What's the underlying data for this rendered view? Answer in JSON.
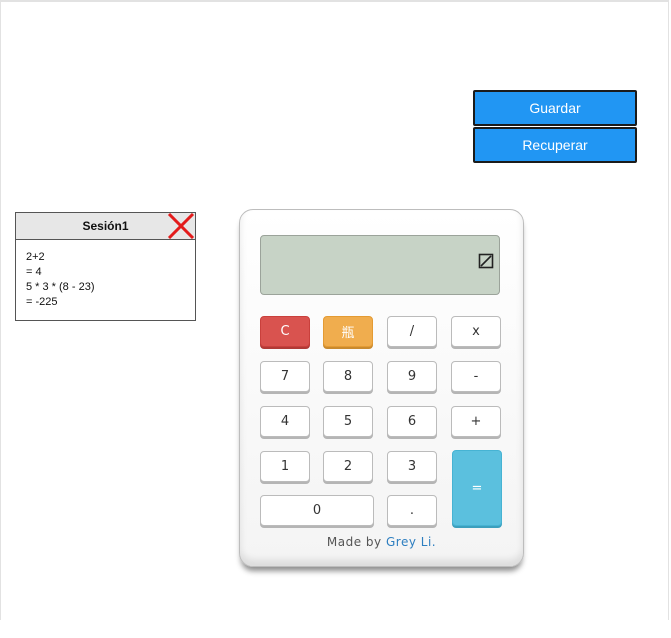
{
  "toolbar": {
    "save_label": "Guardar",
    "restore_label": "Recuperar"
  },
  "session": {
    "title": "Sesión1",
    "lines": [
      "2+2",
      "= 4",
      "5 * 3 * (8 - 23)",
      "= -225"
    ],
    "close_icon": "close-x-icon",
    "close_color": "#e31b1b"
  },
  "calculator": {
    "display_icon": "backspace-square-icon",
    "keys": {
      "clear": "C",
      "orange": "瓶",
      "divide": "/",
      "multiply": "x",
      "seven": "7",
      "eight": "8",
      "nine": "9",
      "minus": "-",
      "four": "4",
      "five": "5",
      "six": "6",
      "plus": "+",
      "one": "1",
      "two": "2",
      "three": "3",
      "equals": "=",
      "zero": "0",
      "dot": "."
    },
    "credit_prefix": "Made by",
    "credit_author": "Grey Li."
  },
  "colors": {
    "primary_button": "#2196f3",
    "clear_key": "#d9534f",
    "orange_key": "#f0ad4e",
    "equals_key": "#5bc0de",
    "screen": "#c7d3c6"
  }
}
